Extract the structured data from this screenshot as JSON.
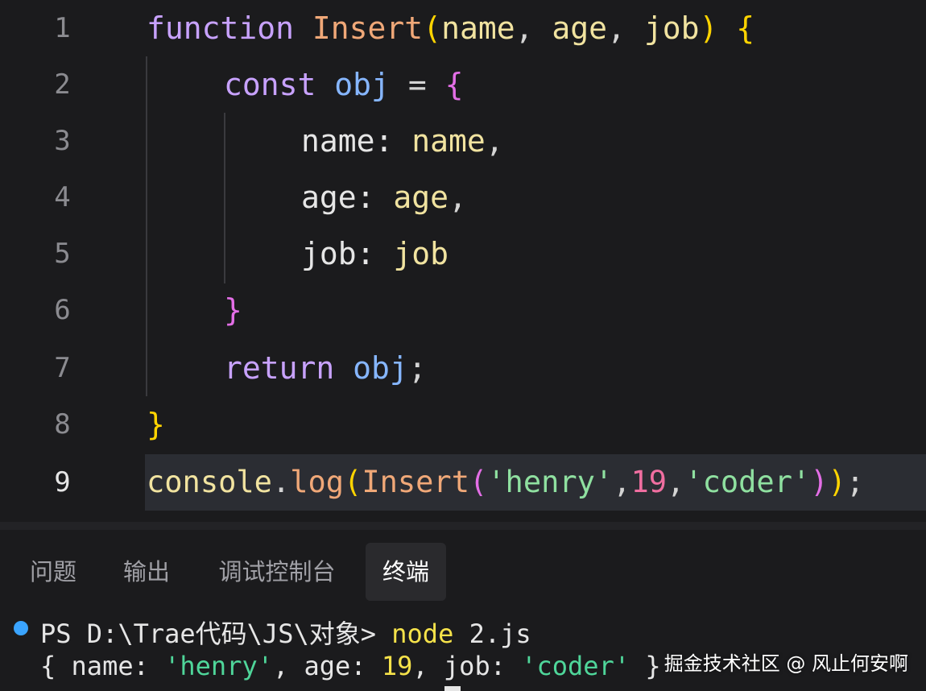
{
  "editor": {
    "line_numbers": [
      "1",
      "2",
      "3",
      "4",
      "5",
      "6",
      "7",
      "8",
      "9"
    ],
    "active_line": "9",
    "lines": {
      "l1": {
        "kw": "function",
        "fn": "Insert",
        "p_open": "(",
        "p1": "name",
        "c1": ",",
        "p2": "age",
        "c2": ",",
        "p3": "job",
        "p_close": ")",
        "brace": "{"
      },
      "l2": {
        "kw": "const",
        "var": "obj",
        "eq": "=",
        "brace": "{"
      },
      "l3": {
        "prop": "name:",
        "val": "name",
        "comma": ","
      },
      "l4": {
        "prop": "age:",
        "val": "age",
        "comma": ","
      },
      "l5": {
        "prop": "job:",
        "val": "job"
      },
      "l6": {
        "brace": "}"
      },
      "l7": {
        "kw": "return",
        "var": "obj",
        "semi": ";"
      },
      "l8": {
        "brace": "}"
      },
      "l9": {
        "console": "console",
        "dot": ".",
        "method": "log",
        "po1": "(",
        "fn": "Insert",
        "po2": "(",
        "s1": "'henry'",
        "c1": ",",
        "n1": "19",
        "c2": ",",
        "s2": "'coder'",
        "pc2": ")",
        "pc1": ")",
        "semi": ";"
      }
    }
  },
  "panel": {
    "tabs": [
      "问题",
      "输出",
      "调试控制台",
      "终端"
    ],
    "active_tab": "终端"
  },
  "terminal": {
    "prompt": "PS D:\\Trae代码\\JS\\对象>",
    "command": "node",
    "arg": "2.js",
    "out_open": "{ name:",
    "out_name": "'henry'",
    "out_age_label": ", age:",
    "out_age": "19",
    "out_job_label": ", job:",
    "out_job": "'coder'",
    "out_close": " }"
  },
  "watermark": "掘金技术社区 @ 风止何安啊",
  "colors": {
    "background": "#1b1b1d",
    "keyword": "#c8a2ff",
    "function": "#f0a878",
    "string": "#8fe0a0",
    "number": "#f06ea0",
    "terminal_accent": "#f5e24a",
    "terminal_string": "#4fd69a",
    "status_dot": "#3aa4ff"
  }
}
